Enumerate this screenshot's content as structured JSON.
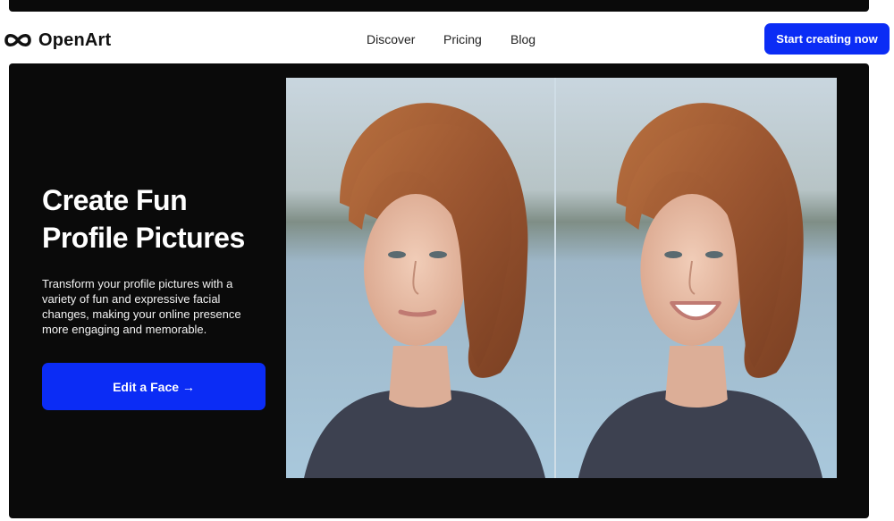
{
  "brand": {
    "name": "OpenArt",
    "logo_icon": "infinity-icon"
  },
  "nav": {
    "items": [
      {
        "label": "Discover"
      },
      {
        "label": "Pricing"
      },
      {
        "label": "Blog"
      }
    ],
    "cta_label": "Start creating now"
  },
  "hero": {
    "title_line1": "Create Fun",
    "title_line2": "Profile Pictures",
    "description": "Transform your profile pictures with a variety of fun and expressive facial changes, making your online presence more engaging and memorable.",
    "button_label": "Edit a Face →"
  },
  "colors": {
    "accent": "#0b2cf5",
    "hero_bg": "#0a0a0a",
    "text_dark": "#111111"
  }
}
